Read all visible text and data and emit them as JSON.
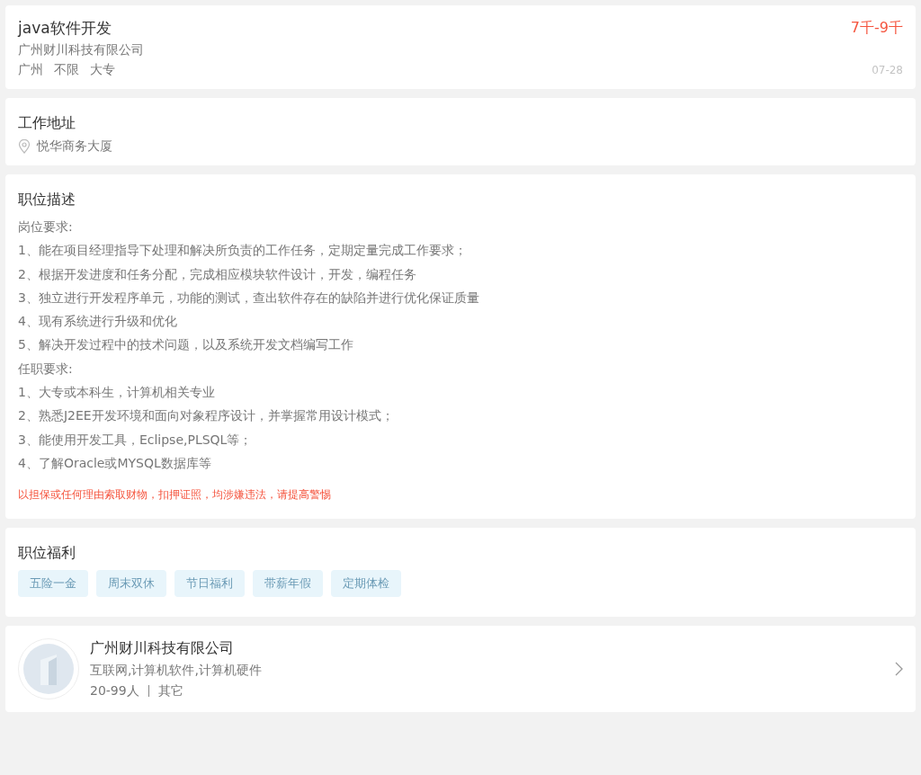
{
  "job": {
    "title": "java软件开发",
    "salary": "7千-9千",
    "company": "广州财川科技有限公司",
    "tags": [
      "广州",
      "不限",
      "大专"
    ],
    "date": "07-28"
  },
  "address": {
    "heading": "工作地址",
    "location": "悦华商务大厦"
  },
  "description": {
    "heading": "职位描述",
    "lines": [
      "岗位要求:",
      "1、能在项目经理指导下处理和解决所负责的工作任务，定期定量完成工作要求；",
      "2、根据开发进度和任务分配，完成相应模块软件设计，开发，编程任务",
      "3、独立进行开发程序单元，功能的测试，查出软件存在的缺陷并进行优化保证质量",
      "4、现有系统进行升级和优化",
      "5、解决开发过程中的技术问题，以及系统开发文档编写工作",
      "任职要求:",
      "1、大专或本科生，计算机相关专业",
      "2、熟悉J2EE开发环境和面向对象程序设计，并掌握常用设计模式；",
      "3、能使用开发工具，Eclipse,PLSQL等；",
      "4、了解Oracle或MYSQL数据库等"
    ],
    "warning": "以担保或任何理由索取财物，扣押证照，均涉嫌违法，请提高警惕"
  },
  "benefits": {
    "heading": "职位福利",
    "tags": [
      "五险一金",
      "周末双休",
      "节日福利",
      "带薪年假",
      "定期体检"
    ]
  },
  "company": {
    "name": "广州财川科技有限公司",
    "industry": "互联网,计算机软件,计算机硬件",
    "size": "20-99人",
    "type": "其它"
  }
}
